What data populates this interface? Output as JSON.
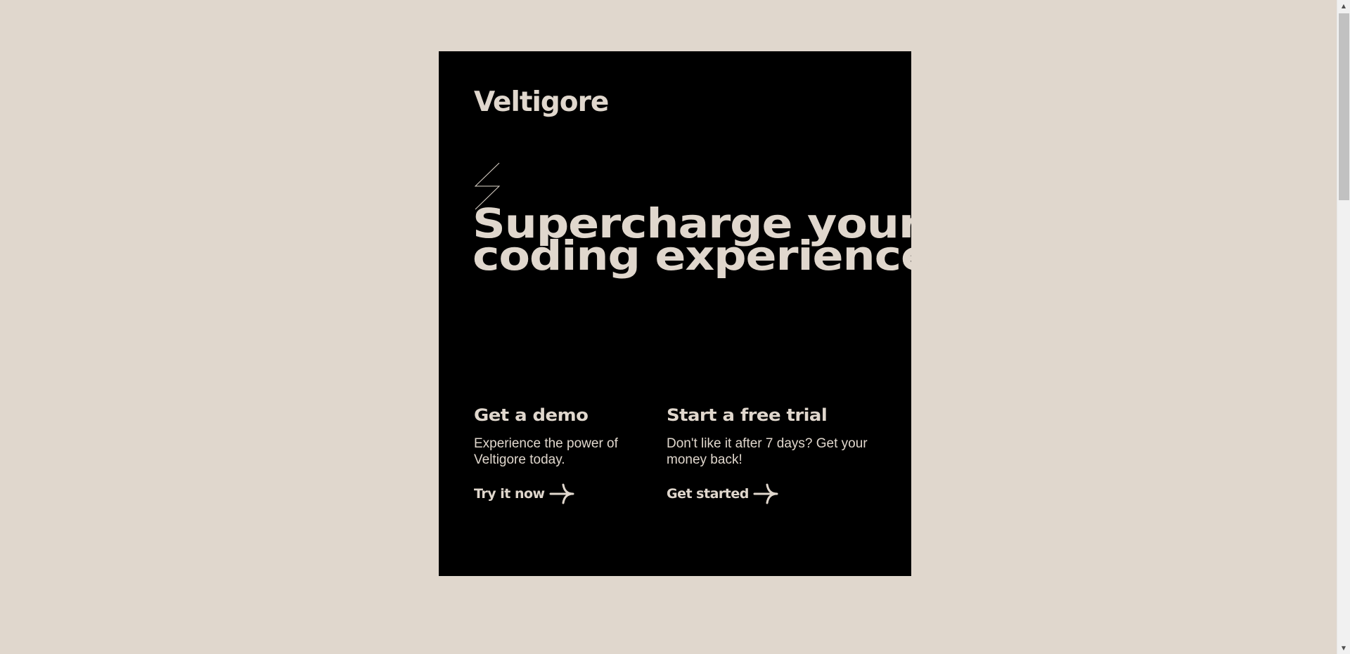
{
  "brand": {
    "name": "Veltigore"
  },
  "hero": {
    "headline": "Supercharge your\ncoding experience",
    "icon": "lightning-bolt-icon"
  },
  "offers": [
    {
      "title": "Get a demo",
      "description": "Experience the power of Veltigore today.",
      "cta_label": "Try it now",
      "cta_icon": "arrow-right-icon"
    },
    {
      "title": "Start a free trial",
      "description": "Don't like it after 7 days? Get your money back!",
      "cta_label": "Get started",
      "cta_icon": "arrow-right-icon"
    }
  ],
  "colors": {
    "background": "#e0d7cd",
    "card": "#000000",
    "text": "#e0d7cd"
  },
  "scrollbar": {
    "up_icon": "scroll-up-arrow-icon",
    "down_icon": "scroll-down-arrow-icon"
  }
}
